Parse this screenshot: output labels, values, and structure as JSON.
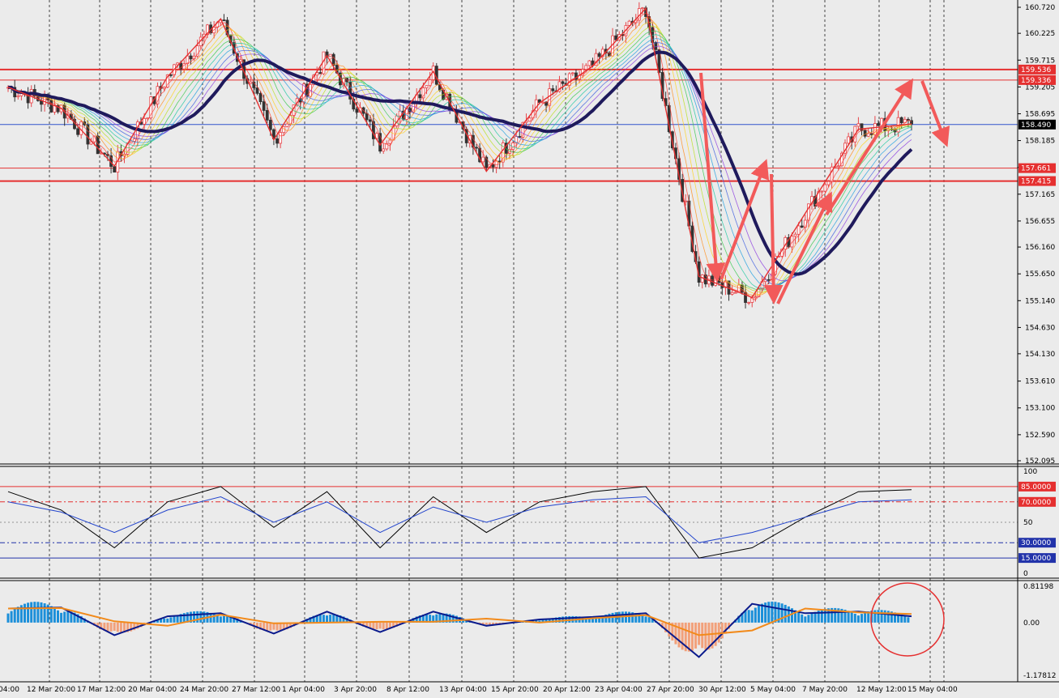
{
  "colors": {
    "background": "#ebebeb",
    "grid": "#000000",
    "bull": "#e8454a",
    "bear": "#333333",
    "zigzag": "#e53030",
    "slow_ma": "#1f1a5c",
    "level": "#e53030",
    "current_price": "#3355cc",
    "arrow": "#f25a5a",
    "macd_pos": "#1b8fd9",
    "macd_neg": "#f2a07a",
    "macd_line": "#0a1a8c",
    "signal_line": "#f28a1a"
  },
  "price_axis": {
    "ticks": [
      "160.720",
      "160.225",
      "159.715",
      "159.205",
      "158.695",
      "158.185",
      "157.675",
      "157.165",
      "156.655",
      "156.160",
      "155.650",
      "155.140",
      "154.630",
      "154.130",
      "153.610",
      "153.100",
      "152.590",
      "152.095"
    ],
    "range": [
      152.095,
      160.72
    ]
  },
  "price_tags": [
    {
      "label": "159.536",
      "value": 159.536,
      "kind": "level"
    },
    {
      "label": "159.336",
      "value": 159.336,
      "kind": "level"
    },
    {
      "label": "158.490",
      "value": 158.49,
      "kind": "current"
    },
    {
      "label": "157.661",
      "value": 157.661,
      "kind": "level"
    },
    {
      "label": "157.415",
      "value": 157.415,
      "kind": "level"
    }
  ],
  "time_axis": {
    "labels": [
      "04:00",
      "12 Mar 20:00",
      "17 Mar 12:00",
      "20 Mar 04:00",
      "24 Mar 20:00",
      "27 Mar 12:00",
      "1 Apr 04:00",
      "3 Apr 20:00",
      "8 Apr 12:00",
      "13 Apr 04:00",
      "15 Apr 20:00",
      "20 Apr 12:00",
      "23 Apr 04:00",
      "27 Apr 20:00",
      "30 Apr 12:00",
      "5 May 04:00",
      "7 May 20:00",
      "12 May 12:00",
      "15 May 04:00"
    ]
  },
  "rsi_axis": {
    "ticks": [
      "100",
      "50",
      "0"
    ],
    "levels": [
      {
        "label": "85.0000",
        "value": 85
      },
      {
        "label": "70.0000",
        "value": 70
      },
      {
        "label": "30.0000",
        "value": 30
      },
      {
        "label": "15.0000",
        "value": 15
      }
    ]
  },
  "macd_axis": {
    "ticks": [
      "0.81198",
      "0.00",
      "-1.17812"
    ],
    "range": [
      -1.17812,
      0.81198
    ]
  },
  "chart_data": [
    {
      "type": "line",
      "panel": "price",
      "x_labels": [
        "12 Mar",
        "17 Mar",
        "20 Mar",
        "24 Mar",
        "27 Mar",
        "1 Apr",
        "3 Apr",
        "8 Apr",
        "13 Apr",
        "15 Apr",
        "20 Apr",
        "23 Apr",
        "27 Apr",
        "30 Apr",
        "5 May",
        "7 May",
        "12 May",
        "15 May"
      ],
      "series": [
        {
          "values": [
            159.2,
            158.8,
            157.7,
            159.4,
            160.5,
            158.2,
            159.8,
            158.1,
            159.5,
            157.6,
            158.9,
            159.6,
            160.7,
            155.6,
            155.2,
            156.8,
            158.4,
            158.5
          ]
        }
      ],
      "levels": [
        159.536,
        159.336,
        158.49,
        157.661,
        157.415
      ],
      "ylim": [
        152.095,
        160.72
      ]
    },
    {
      "type": "line",
      "panel": "rsi",
      "ylim": [
        0,
        100
      ],
      "series": [
        {
          "values": [
            80,
            62,
            25,
            70,
            85,
            45,
            80,
            25,
            75,
            40,
            70,
            80,
            85,
            15,
            25,
            55,
            80,
            82
          ]
        },
        {
          "values": [
            70,
            60,
            40,
            62,
            75,
            50,
            70,
            40,
            65,
            50,
            65,
            72,
            75,
            30,
            40,
            55,
            70,
            72
          ]
        }
      ]
    },
    {
      "type": "bar",
      "panel": "macd",
      "ylim": [
        -1.17812,
        0.81198
      ],
      "values": [
        0.45,
        0.48,
        -0.4,
        0.2,
        0.3,
        -0.35,
        0.35,
        -0.3,
        0.35,
        -0.1,
        0.1,
        0.18,
        0.3,
        -1.1,
        0.6,
        0.3,
        0.35,
        0.2
      ]
    }
  ]
}
